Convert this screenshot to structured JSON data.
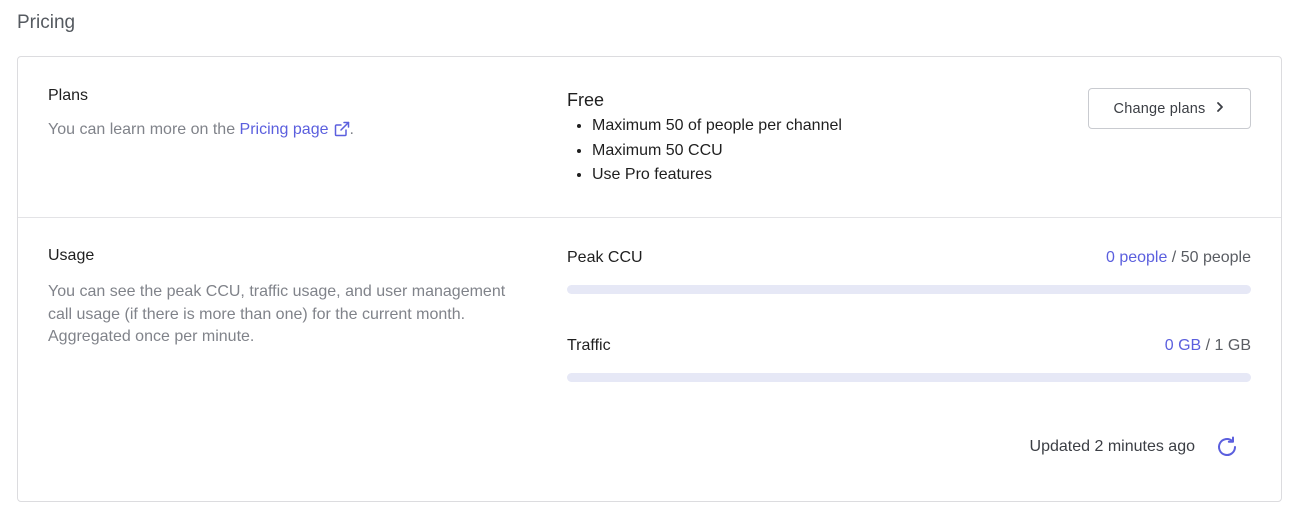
{
  "page": {
    "title": "Pricing"
  },
  "plans": {
    "title": "Plans",
    "description_prefix": "You can learn more on the ",
    "link_text": "Pricing page",
    "description_suffix": ".",
    "current_plan": "Free",
    "features": [
      "Maximum 50 of people per channel",
      "Maximum 50 CCU",
      "Use Pro features"
    ],
    "change_button_label": "Change plans"
  },
  "usage": {
    "title": "Usage",
    "description": "You can see the peak CCU, traffic usage, and user management call usage (if there is more than one) for the current month. Aggregated once per minute.",
    "metrics": [
      {
        "label": "Peak CCU",
        "current": "0 people",
        "separator": " / ",
        "limit": "50 people",
        "fraction": 0
      },
      {
        "label": "Traffic",
        "current": "0 GB",
        "separator": " / ",
        "limit": "1 GB",
        "fraction": 0
      }
    ],
    "updated_text": "Updated 2 minutes ago"
  },
  "colors": {
    "accent": "#5b5fde",
    "bar_track": "#e6e8f6",
    "muted_text": "#80838a",
    "border": "#dcdcdf"
  },
  "icons": {
    "external_link": "external-link-icon",
    "chevron": "chevron-right-icon",
    "refresh": "refresh-icon"
  }
}
